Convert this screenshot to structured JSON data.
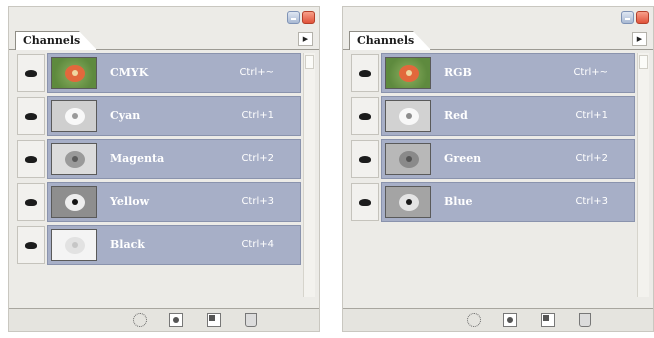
{
  "colors": {
    "row_selected": "#a7afc7",
    "panel_bg": "#ecebe7",
    "close_button": "#e0523a",
    "minimize_button": "#a9b9d3"
  },
  "panels": [
    {
      "tab_label": "Channels",
      "menu_icon": "triangle-menu-icon",
      "channels": [
        {
          "name": "CMYK",
          "shortcut": "Ctrl+~",
          "visible": true
        },
        {
          "name": "Cyan",
          "shortcut": "Ctrl+1",
          "visible": true
        },
        {
          "name": "Magenta",
          "shortcut": "Ctrl+2",
          "visible": true
        },
        {
          "name": "Yellow",
          "shortcut": "Ctrl+3",
          "visible": true
        },
        {
          "name": "Black",
          "shortcut": "Ctrl+4",
          "visible": true
        }
      ],
      "bottom_icons": [
        "load-selection-icon",
        "save-selection-icon",
        "new-channel-icon",
        "delete-channel-icon"
      ]
    },
    {
      "tab_label": "Channels",
      "menu_icon": "triangle-menu-icon",
      "channels": [
        {
          "name": "RGB",
          "shortcut": "Ctrl+~",
          "visible": true
        },
        {
          "name": "Red",
          "shortcut": "Ctrl+1",
          "visible": true
        },
        {
          "name": "Green",
          "shortcut": "Ctrl+2",
          "visible": true
        },
        {
          "name": "Blue",
          "shortcut": "Ctrl+3",
          "visible": true
        }
      ],
      "bottom_icons": [
        "load-selection-icon",
        "save-selection-icon",
        "new-channel-icon",
        "delete-channel-icon"
      ]
    }
  ]
}
